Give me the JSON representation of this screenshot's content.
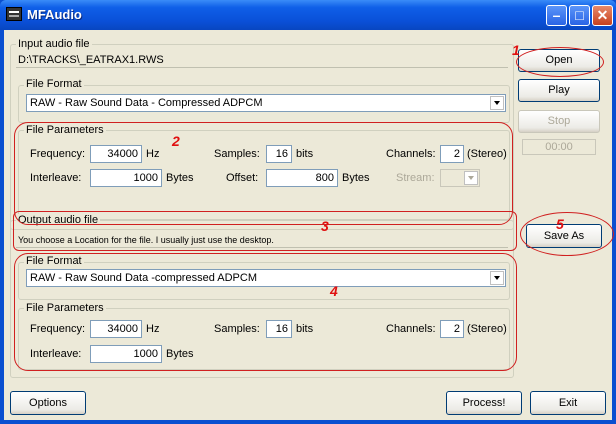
{
  "window": {
    "title": "MFAudio",
    "accent": "#0a4fd0",
    "annotation_color": "#d02020"
  },
  "input": {
    "group_label": "Input audio file",
    "path": "D:\\TRACKS\\_EATRAX1.RWS",
    "format_label": "File Format",
    "format_value": "RAW - Raw Sound Data - Compressed ADPCM",
    "params_label": "File Parameters",
    "frequency_label": "Frequency:",
    "frequency_value": "34000",
    "frequency_unit": "Hz",
    "samples_label": "Samples:",
    "samples_value": "16",
    "samples_unit": "bits",
    "channels_label": "Channels:",
    "channels_value": "2",
    "channels_note": "(Stereo)",
    "interleave_label": "Interleave:",
    "interleave_value": "1000",
    "interleave_unit": "Bytes",
    "offset_label": "Offset:",
    "offset_value": "800",
    "offset_unit": "Bytes",
    "stream_label": "Stream:"
  },
  "output": {
    "group_label": "Output audio file",
    "path_text": "You choose a Location for the file. I usually just use the desktop.",
    "format_label": "File Format",
    "format_value": "RAW - Raw Sound Data -compressed ADPCM",
    "params_label": "File Parameters",
    "frequency_label": "Frequency:",
    "frequency_value": "34000",
    "frequency_unit": "Hz",
    "samples_label": "Samples:",
    "samples_value": "16",
    "samples_unit": "bits",
    "channels_label": "Channels:",
    "channels_value": "2",
    "channels_note": "(Stereo)",
    "interleave_label": "Interleave:",
    "interleave_value": "1000",
    "interleave_unit": "Bytes"
  },
  "buttons": {
    "open": "Open",
    "play": "Play",
    "stop": "Stop",
    "time": "00:00",
    "save_as": "Save As",
    "options": "Options",
    "process": "Process!",
    "exit": "Exit"
  },
  "annotations": {
    "n1": "1",
    "n2": "2",
    "n3": "3",
    "n4": "4",
    "n5": "5"
  }
}
